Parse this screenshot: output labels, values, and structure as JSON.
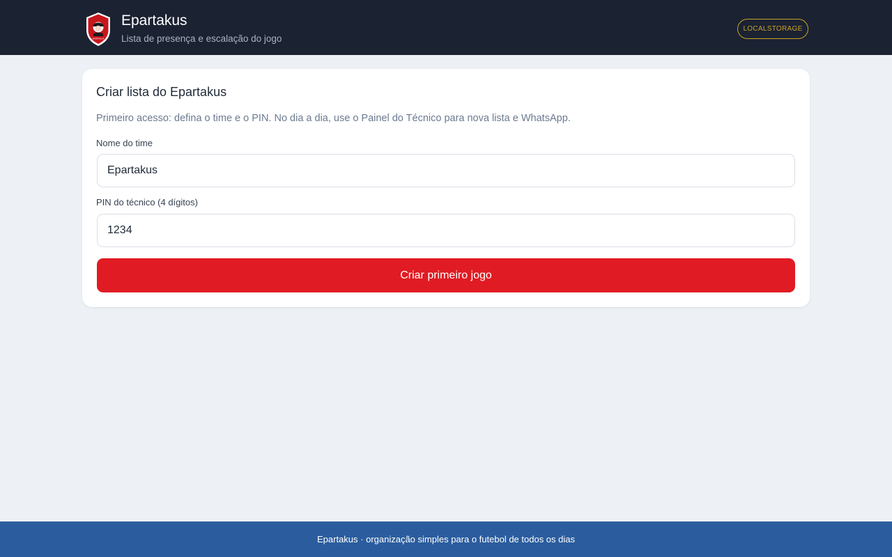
{
  "header": {
    "title": "Epartakus",
    "subtitle": "Lista de presença e escalação do jogo",
    "storage_badge": "LOCALSTORAGE",
    "logo_text": "EPARTAKUS"
  },
  "form": {
    "title": "Criar lista do Epartakus",
    "description": "Primeiro acesso: defina o time e o PIN. No dia a dia, use o Painel do Técnico para nova lista e WhatsApp.",
    "team_label": "Nome do time",
    "team_value": "Epartakus",
    "pin_label": "PIN do técnico (4 dígitos)",
    "pin_value": "1234",
    "submit_label": "Criar primeiro jogo"
  },
  "footer": {
    "text": "Epartakus · organização simples para o futebol de todos os dias"
  },
  "colors": {
    "header_bg": "#1b2232",
    "accent_red": "#e11b23",
    "badge_gold": "#c9a227",
    "footer_bg": "#2b5d9e",
    "page_bg": "#edf1f5"
  }
}
